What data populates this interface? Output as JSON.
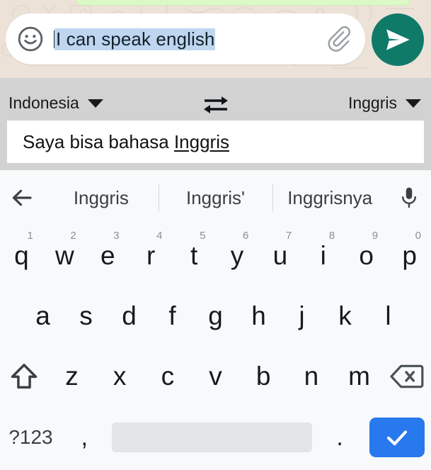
{
  "chat": {
    "composer": {
      "emoji_icon": "smiley-face-icon",
      "text": "I can speak english",
      "text_selected": true,
      "attach_icon": "paperclip-icon",
      "send_icon": "send-plane-icon",
      "send_button_color": "#0f7a68",
      "selection_color": "#bed6f0",
      "background_color": "#ece2d8"
    }
  },
  "translate": {
    "source_language": "Indonesia",
    "target_language": "Inggris",
    "swap_icon": "swap-horizontal-arrows-icon",
    "dropdown_icon": "chevron-down-icon",
    "result_prefix": "Saya bisa bahasa ",
    "result_underlined": "Inggris",
    "bar_color": "#d2d2d2"
  },
  "keyboard": {
    "back_icon": "back-arrow-icon",
    "mic_icon": "microphone-icon",
    "suggestions": [
      {
        "label": "Inggris"
      },
      {
        "label": "Inggris'"
      },
      {
        "label": "Inggrisnya"
      }
    ],
    "row1": [
      {
        "key": "q",
        "num": "1"
      },
      {
        "key": "w",
        "num": "2"
      },
      {
        "key": "e",
        "num": "3"
      },
      {
        "key": "r",
        "num": "4"
      },
      {
        "key": "t",
        "num": "5"
      },
      {
        "key": "y",
        "num": "6"
      },
      {
        "key": "u",
        "num": "7"
      },
      {
        "key": "i",
        "num": "8"
      },
      {
        "key": "o",
        "num": "9"
      },
      {
        "key": "p",
        "num": "0"
      }
    ],
    "row2": [
      {
        "key": "a"
      },
      {
        "key": "s"
      },
      {
        "key": "d"
      },
      {
        "key": "f"
      },
      {
        "key": "g"
      },
      {
        "key": "h"
      },
      {
        "key": "j"
      },
      {
        "key": "k"
      },
      {
        "key": "l"
      }
    ],
    "row3": [
      {
        "key": "z"
      },
      {
        "key": "x"
      },
      {
        "key": "c"
      },
      {
        "key": "v"
      },
      {
        "key": "b"
      },
      {
        "key": "n"
      },
      {
        "key": "m"
      }
    ],
    "shift_icon": "shift-arrow-icon",
    "backspace_icon": "backspace-delete-icon",
    "symbols_label": "?123",
    "comma_label": ",",
    "space_label": "",
    "period_label": ".",
    "enter_icon": "checkmark-icon",
    "enter_key_color": "#2878ee",
    "background_color": "#f7f9fa"
  }
}
